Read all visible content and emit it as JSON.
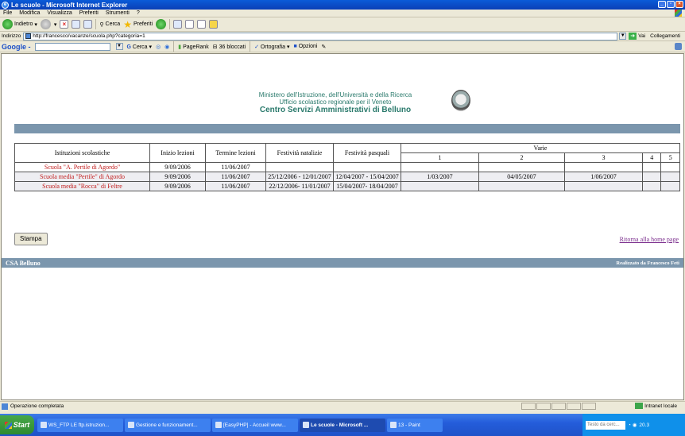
{
  "window": {
    "title": "Le scuole - Microsoft Internet Explorer"
  },
  "menu": [
    "File",
    "Modifica",
    "Visualizza",
    "Preferiti",
    "Strumenti",
    "?"
  ],
  "toolbar": {
    "back_label": "Indietro",
    "search_label": "Cerca",
    "favorites_label": "Preferiti"
  },
  "address": {
    "label": "Indirizzo",
    "url": "http://francesco/vacanze/scuola.php?categoria=1",
    "go_label": "Vai",
    "links_label": "Collegamenti"
  },
  "googlebar": {
    "logo": "Google -",
    "search_label": "Cerca",
    "pagerank_label": "PageRank",
    "blocked_label": "36 bloccati",
    "spelling_label": "Ortografia",
    "options_label": "Opzioni"
  },
  "page": {
    "header_line1": "Ministero dell'Istruzione, dell'Università e della Ricerca",
    "header_line2": "Ufficio scolastico regionale per il Veneto",
    "header_line3": "Centro Servizi Amministrativi di Belluno",
    "table": {
      "headers": [
        "Istituzioni scolastiche",
        "Inizio lezioni",
        "Termine lezioni",
        "Festività natalizie",
        "Festività pasquali"
      ],
      "varie_label": "Varie",
      "varie_cols": [
        "1",
        "2",
        "3",
        "4",
        "5"
      ],
      "rows": [
        {
          "school": "Scuola \"A. Pertile di Agordo\"",
          "start": "9/09/2006",
          "end": "11/06/2007",
          "xmas": "",
          "easter": "",
          "v1": "",
          "v2": "",
          "v3": "",
          "v4": "",
          "v5": ""
        },
        {
          "school": "Scuola media \"Pertile\" di Agordo",
          "start": "9/09/2006",
          "end": "11/06/2007",
          "xmas": "25/12/2006 - 12/01/2007",
          "easter": "12/04/2007 - 15/04/2007",
          "v1": "1/03/2007",
          "v2": "04/05/2007",
          "v3": "1/06/2007",
          "v4": "",
          "v5": ""
        },
        {
          "school": "Scuola media \"Rocca\" di Feltre",
          "start": "9/09/2006",
          "end": "11/06/2007",
          "xmas": "22/12/2006- 11/01/2007",
          "easter": "15/04/2007- 18/04/2007",
          "v1": "",
          "v2": "",
          "v3": "",
          "v4": "",
          "v5": ""
        }
      ]
    },
    "print_button": "Stampa",
    "home_link": "Ritorna alla home page",
    "footer_left": "CSA Belluno",
    "footer_right": "Realizzato da Francesco Feti"
  },
  "status": {
    "text": "Operazione completata",
    "zone": "Intranet locale"
  },
  "taskbar": {
    "start": "Start",
    "tasks": [
      "WS_FTP LE ftp.istruzion...",
      "Gestione e funzionament...",
      "[EasyPHP] - Accueil www...",
      "Le scuole - Microsoft ...",
      "13 - Paint"
    ],
    "tray_search": "Testo da cerc...",
    "clock": "20.3"
  }
}
